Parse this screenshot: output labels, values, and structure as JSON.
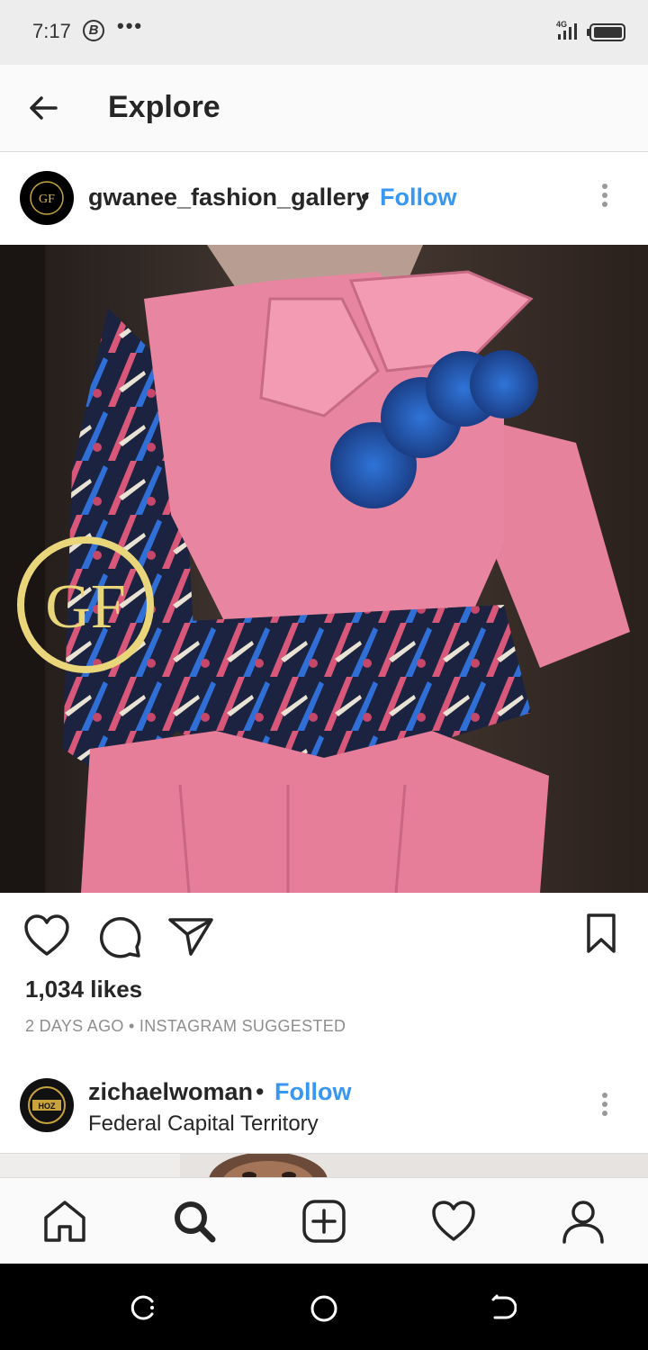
{
  "status_bar": {
    "time": "7:17",
    "b_badge": "B",
    "dots": "•••",
    "network": "4G"
  },
  "app_bar": {
    "back_icon": "arrow-left-icon",
    "title": "Explore"
  },
  "post1": {
    "username": "gwanee_fashion_gallery",
    "separator": "•",
    "follow_label": "Follow",
    "avatar_text": "GF",
    "image_watermark": "GF",
    "likes": "1,034 likes",
    "meta": "2 DAYS AGO • INSTAGRAM SUGGESTED"
  },
  "post2": {
    "username": "zichaelwoman",
    "separator": "•",
    "follow_label": "Follow",
    "location": "Federal Capital Territory",
    "avatar_text": "HOZ"
  },
  "colors": {
    "link": "#3897f0",
    "text": "#262626",
    "muted": "#8e8e8e",
    "statusbar": "#ededed",
    "navbar": "#000000"
  },
  "tabs": [
    "home-icon",
    "search-icon",
    "add-post-icon",
    "activity-heart-icon",
    "profile-icon"
  ],
  "system_nav": [
    "recent-apps-icon",
    "home-circle-icon",
    "back-nav-icon"
  ]
}
